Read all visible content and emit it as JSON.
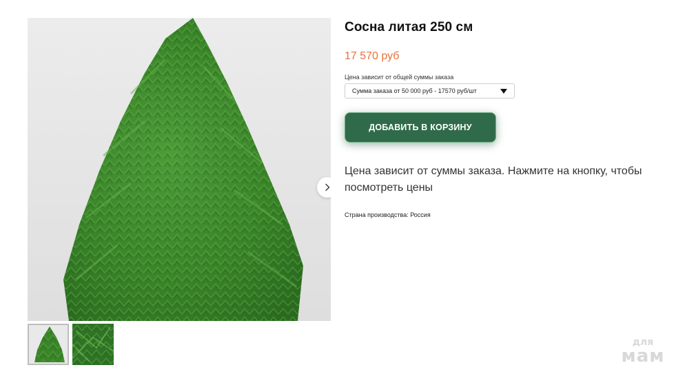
{
  "product": {
    "title": "Сосна литая 250 см",
    "price": "17 570 руб",
    "tier_label": "Цена зависит от общей суммы заказа",
    "tier_selected": "Сумма заказа от 50 000 руб - 17570 руб/шт",
    "add_to_cart_label": "ДОБАВИТЬ В КОРЗИНУ",
    "description": "Цена зависит от суммы заказа. Нажмите на кнопку, чтобы посмотреть цены",
    "country": "Страна производства: Россия"
  },
  "gallery": {
    "next_icon": "chevron-right-icon",
    "thumbnails": [
      {
        "name": "full-tree",
        "active": true
      },
      {
        "name": "branch-closeup",
        "active": false
      }
    ]
  },
  "watermark": {
    "line1": "для",
    "line2": "мам"
  },
  "colors": {
    "price": "#e8713a",
    "button_bg": "#2f6b4a",
    "button_border": "#6fb48a",
    "tree_green": "#3f8a2e"
  }
}
